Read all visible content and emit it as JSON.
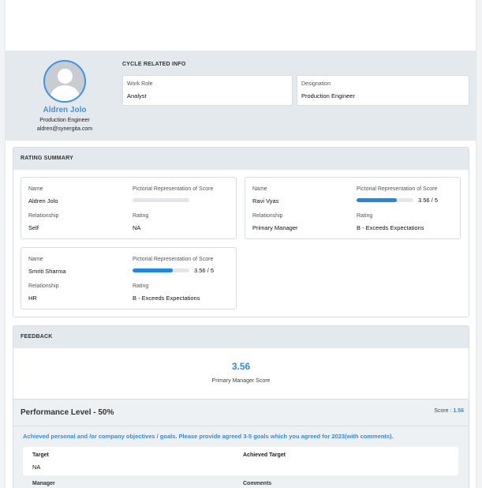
{
  "profile": {
    "name": "Aldren Jolo",
    "role": "Production Engineer",
    "email": "aldren@synergita.com"
  },
  "cycle_info": {
    "title": "CYCLE RELATED INFO",
    "work_role_label": "Work Role",
    "work_role_value": "Analyst",
    "designation_label": "Designation",
    "designation_value": "Production Engineer"
  },
  "rating_summary": {
    "title": "RATING SUMMARY",
    "labels": {
      "name": "Name",
      "pictorial": "Pictorial Representation of Score",
      "relationship": "Relationship",
      "rating": "Rating"
    },
    "raters": [
      {
        "name": "Aldren Jolo",
        "relationship": "Self",
        "rating": "NA",
        "score_text": "",
        "score_fraction": 0
      },
      {
        "name": "Ravi Vyas",
        "relationship": "Primary Manager",
        "rating": "B - Exceeds Expectations",
        "score_text": "3.56 / 5",
        "score_fraction": 0.712
      },
      {
        "name": "Smriti Sharma",
        "relationship": "HR",
        "rating": "B - Exceeds Expectations",
        "score_text": "3.56 / 5",
        "score_fraction": 0.712
      }
    ]
  },
  "feedback": {
    "title": "FEEDBACK",
    "score": "3.56",
    "score_label": "Primary Manager Score",
    "performance_title": "Performance Level - 50%",
    "performance_score_label": "Score :",
    "performance_score_value": "1.56",
    "description": "Achieved personal and /or company objectives / goals. Please provide agreed 3-5 goals which you agreed for 2023(with comments).",
    "target_label": "Target",
    "target_value": "NA",
    "achieved_target_label": "Achieved Target",
    "next_left_label": "Manager",
    "next_right_label": "Comments"
  },
  "colors": {
    "accent": "#2f8ce6",
    "progress": "#1e88e5",
    "band": "#e4e9ee"
  }
}
